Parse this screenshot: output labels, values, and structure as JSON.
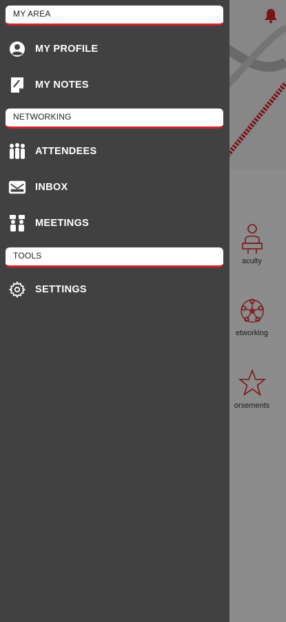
{
  "drawer": {
    "sections": [
      {
        "header": "MY AREA",
        "items": [
          {
            "label": "MY PROFILE",
            "icon": "profile-icon"
          },
          {
            "label": "MY NOTES",
            "icon": "notes-icon"
          }
        ]
      },
      {
        "header": "NETWORKING",
        "items": [
          {
            "label": "ATTENDEES",
            "icon": "attendees-icon"
          },
          {
            "label": "INBOX",
            "icon": "inbox-icon"
          },
          {
            "label": "MEETINGS",
            "icon": "meetings-icon"
          }
        ]
      },
      {
        "header": "TOOLS",
        "items": [
          {
            "label": "SETTINGS",
            "icon": "gear-icon"
          }
        ]
      }
    ]
  },
  "background": {
    "tiles": [
      {
        "label": "aculty",
        "icon": "faculty-icon"
      },
      {
        "label": "etworking",
        "icon": "networking-icon"
      },
      {
        "label": "orsements",
        "icon": "star-icon"
      }
    ]
  },
  "colors": {
    "accent": "#d3232b",
    "drawer_bg": "#414141",
    "header_bg": "#ffffff"
  }
}
